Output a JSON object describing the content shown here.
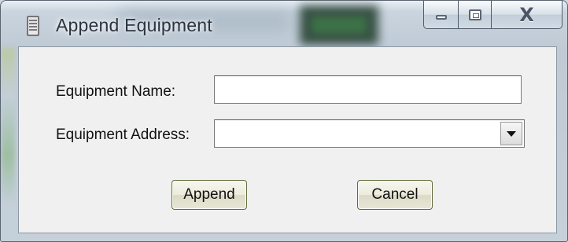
{
  "window": {
    "title": "Append Equipment",
    "icon": "app-icon",
    "controls": {
      "minimize": "minimize-icon",
      "maximize": "maximize-icon",
      "close_label": "X"
    }
  },
  "form": {
    "equipment_name": {
      "label": "Equipment Name:",
      "value": ""
    },
    "equipment_address": {
      "label": "Equipment Address:",
      "value": ""
    }
  },
  "buttons": {
    "append": "Append",
    "cancel": "Cancel"
  },
  "colors": {
    "window_frame": "#c6d0da",
    "client_bg": "#f0f0f0",
    "button_border": "#5e6b3a"
  }
}
